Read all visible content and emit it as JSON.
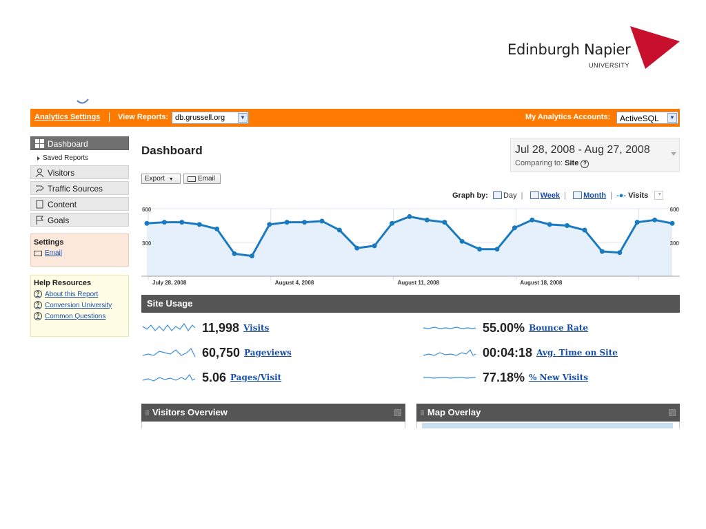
{
  "logo": {
    "name": "Edinburgh Napier",
    "sub": "UNIVERSITY",
    "brand_color": "#c8102e"
  },
  "topbar": {
    "settings_link": "Analytics Settings",
    "view_reports": "View Reports:",
    "site": "db.grussell.org",
    "accounts_label": "My Analytics Accounts:",
    "account": "ActiveSQL",
    "accent_color": "#ff7a00"
  },
  "sidebar": {
    "items": [
      {
        "label": "Dashboard",
        "icon": "dashboard-grid-icon",
        "active": true
      },
      {
        "label": "Saved Reports",
        "icon": "triangle-right-icon"
      },
      {
        "label": "Visitors",
        "icon": "person-icon"
      },
      {
        "label": "Traffic Sources",
        "icon": "traffic-icon"
      },
      {
        "label": "Content",
        "icon": "page-icon"
      },
      {
        "label": "Goals",
        "icon": "flag-icon"
      }
    ],
    "settings": {
      "title": "Settings",
      "email": "Email"
    },
    "help": {
      "title": "Help Resources",
      "links": [
        "About this Report",
        "Conversion University",
        "Common Questions"
      ]
    }
  },
  "main": {
    "title": "Dashboard",
    "date_range": "Jul 28, 2008 - Aug 27, 2008",
    "comparing_label": "Comparing to:",
    "comparing_value": "Site",
    "export": "Export",
    "email": "Email",
    "graph_by": {
      "label": "Graph by:",
      "day": "Day",
      "week": "Week",
      "month": "Month",
      "metric": "Visits"
    }
  },
  "chart_data": {
    "type": "area",
    "y_ticks_left": [
      "600",
      "300"
    ],
    "y_ticks_right": [
      "600",
      "300"
    ],
    "x_tick_labels": [
      "July 28, 2008",
      "August 4, 2008",
      "August 11, 2008",
      "August 18, 2008"
    ],
    "ylim": [
      0,
      600
    ],
    "series": [
      {
        "name": "Visits",
        "values": [
          470,
          480,
          480,
          460,
          420,
          200,
          180,
          460,
          480,
          480,
          490,
          410,
          250,
          270,
          470,
          530,
          500,
          480,
          310,
          240,
          240,
          430,
          500,
          460,
          450,
          410,
          220,
          210,
          480,
          500,
          470
        ]
      }
    ]
  },
  "site_usage": {
    "title": "Site Usage",
    "metrics": [
      {
        "value": "11,998",
        "label": "Visits"
      },
      {
        "value": "60,750",
        "label": "Pageviews"
      },
      {
        "value": "5.06",
        "label": "Pages/Visit"
      },
      {
        "value": "55.00%",
        "label": "Bounce Rate"
      },
      {
        "value": "00:04:18",
        "label": "Avg. Time on Site"
      },
      {
        "value": "77.18%",
        "label": "% New Visits"
      }
    ]
  },
  "panels": {
    "visitors_overview": "Visitors Overview",
    "map_overlay": "Map Overlay"
  }
}
